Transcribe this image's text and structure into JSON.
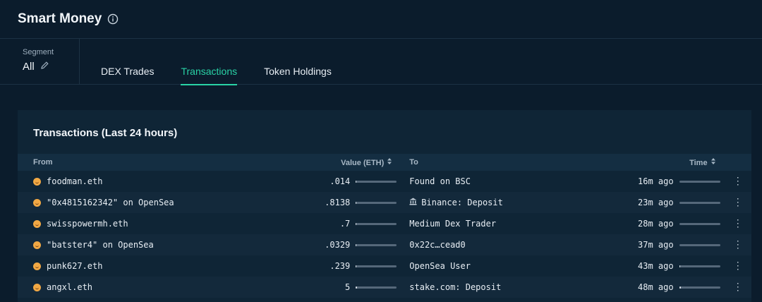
{
  "header": {
    "title": "Smart Money"
  },
  "segment": {
    "label": "Segment",
    "value": "All"
  },
  "tabs": [
    {
      "label": "DEX Trades",
      "active": false
    },
    {
      "label": "Transactions",
      "active": true
    },
    {
      "label": "Token Holdings",
      "active": false
    }
  ],
  "card": {
    "title": "Transactions (Last 24 hours)",
    "columns": {
      "from": "From",
      "value": "Value (ETH)",
      "to": "To",
      "time": "Time"
    }
  },
  "rows": [
    {
      "from": "foodman.eth",
      "value": ".014",
      "value_level": 0.003,
      "to": "Found on BSC",
      "to_icon": "",
      "time": "16m ago",
      "time_level": 0.0
    },
    {
      "from": "\"0x4815162342\" on OpenSea",
      "value": ".8138",
      "value_level": 0.01,
      "to": "Binance: Deposit",
      "to_icon": "bank-icon",
      "time": "23m ago",
      "time_level": 0.0
    },
    {
      "from": "swisspowermh.eth",
      "value": ".7",
      "value_level": 0.01,
      "to": "Medium Dex Trader",
      "to_icon": "",
      "time": "28m ago",
      "time_level": 0.0
    },
    {
      "from": "\"batster4\" on OpenSea",
      "value": ".0329",
      "value_level": 0.005,
      "to": "0x22c…cead0",
      "to_icon": "",
      "time": "37m ago",
      "time_level": 0.0
    },
    {
      "from": "punk627.eth",
      "value": ".239",
      "value_level": 0.008,
      "to": "OpenSea User",
      "to_icon": "",
      "time": "43m ago",
      "time_level": 0.03
    },
    {
      "from": "angxl.eth",
      "value": "5",
      "value_level": 0.03,
      "to": "stake.com: Deposit",
      "to_icon": "",
      "time": "48m ago",
      "time_level": 0.05
    }
  ],
  "colors": {
    "accent": "#29d3a6",
    "background": "#0b1c2c",
    "card": "#0f2536"
  }
}
